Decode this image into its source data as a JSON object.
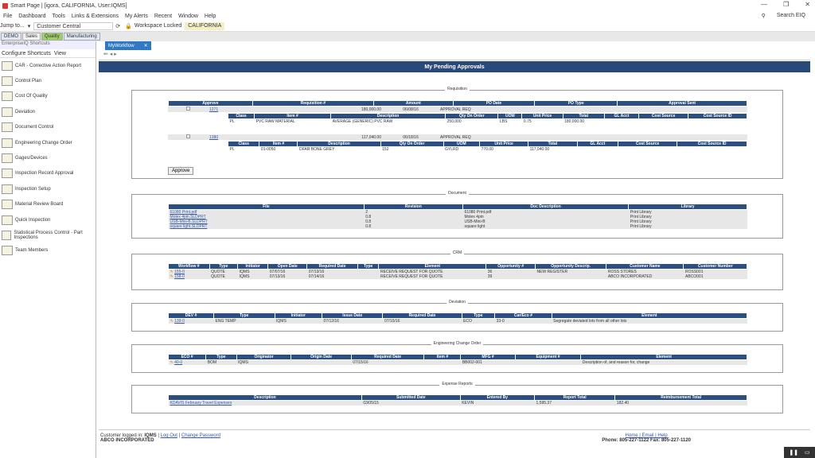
{
  "titlebar": {
    "title": "Smart Page | [igora, CALIFORNIA, User:IQMS]"
  },
  "menu": [
    "File",
    "Dashboard",
    "Tools",
    "Links & Extensions",
    "My Alerts",
    "Recent",
    "Window",
    "Help"
  ],
  "menu_right": "Search EIQ",
  "toolbar": {
    "jump": "Jump to...",
    "customer": "Customer Central",
    "workspace": "Workspace Locked",
    "location": "CALIFORNIA"
  },
  "tabs": [
    "DEMO",
    "Sales",
    "Quality",
    "Manufacturing"
  ],
  "sidebar": {
    "header": "EnterpriseIQ Shortcuts",
    "configure": "Configure Shortcuts",
    "view": "View",
    "items": [
      "CAR - Corrective Action Report",
      "Control Plan",
      "Cost Of Quality",
      "Deviation",
      "Document Control",
      "Engineering Change Order",
      "Gages/Devices",
      "Inspection Record Approval",
      "Inspection Setup",
      "Material Review Board",
      "Quick Inspection",
      "Statistical Process Control - Part Inspections",
      "Team Members"
    ]
  },
  "workflow_tab": "MyWorkflow",
  "page_title": "My Pending Approvals",
  "requisition": {
    "title": "Requisition",
    "headers": [
      "Approve",
      "Requisition #",
      "Amount",
      "PO Date",
      "PO Type",
      "Approval Sent"
    ],
    "sub_headers_1": [
      "Class",
      "Item #",
      "Description",
      "Qty On Order",
      "UOM",
      "Unit Price",
      "Total",
      "GL Acct",
      "Cost Source",
      "Cost Source ID"
    ],
    "rows": [
      {
        "req": "1271",
        "amount": "180,000.00",
        "date": "06/08/16",
        "type": "APPROVAL REQ",
        "line": [
          "PL",
          "PVC RAW MATERIAL",
          "AVERAGE (GENERIC) PVC RAW",
          "250,000",
          "LBS",
          "0.75",
          "180,000.00",
          "",
          "",
          ""
        ]
      },
      {
        "req": "1380",
        "amount": "117,040.00",
        "date": "06/18/16",
        "type": "APPROVAL REQ",
        "line": [
          "PL",
          "01-0050",
          "DFAR BONE GREY",
          "152",
          "GYLRD",
          "770.00",
          "117,040.00",
          "",
          "",
          ""
        ]
      }
    ],
    "approve_button": "Approve"
  },
  "document": {
    "title": "Document",
    "headers": [
      "File",
      "Revision",
      "Doc Description",
      "Library"
    ],
    "rows": [
      [
        "61080 Print.pdf",
        "2",
        "61080 Print.pdf",
        "Print Library"
      ],
      [
        "Molex 4pin.SLDPRT",
        "0.8",
        "Molex 4pin",
        "Print Library"
      ],
      [
        "USB-Mini-B.SLDPRT",
        "0.8",
        "USB-Mini-B",
        "Print Library"
      ],
      [
        "square light.SLDPRT",
        "0.8",
        "square light",
        "Print Library"
      ]
    ]
  },
  "crm": {
    "title": "CRM",
    "headers": [
      "Workflow #",
      "Type",
      "Initiator",
      "Open Date",
      "Required Date",
      "Type",
      "Element",
      "Opportunity #",
      "Opportunity Descrip.",
      "Customer Name",
      "Customer Number"
    ],
    "rows": [
      [
        "155-0",
        "QUOTE",
        "IQMS",
        "07/07/16",
        "07/13/16",
        "",
        "RECEIVE REQUEST FOR QUOTE",
        "36",
        "NEW REGISTER",
        "ROSS STORES",
        "ROSS001"
      ],
      [
        "158-0",
        "QUOTE",
        "IQMS",
        "07/13/16",
        "07/14/16",
        "",
        "RECEIVE REQUEST FOR QUOTE",
        "39",
        "",
        "ABCO INCORPORATED",
        "ABCO001"
      ]
    ]
  },
  "deviation": {
    "title": "Deviation",
    "headers": [
      "DEV #",
      "Type",
      "Initiator",
      "Issue Date",
      "Required Date",
      "Type",
      "Car/Eco #",
      "Element"
    ],
    "rows": [
      [
        "139-0",
        "ENG TEMP",
        "IQMS",
        "07/12/16",
        "07/15/16",
        "ECO",
        "33-0",
        "Segregate deviated lots from all other lots"
      ]
    ]
  },
  "eco": {
    "title": "Engineering Change Order",
    "headers": [
      "ECO #",
      "Type",
      "Originator",
      "Origin Date",
      "Required Date",
      "Item #",
      "MFG #",
      "Equipment #",
      "Element"
    ],
    "rows": [
      [
        "40-0",
        "BOM",
        "IQMS",
        "",
        "07/15/16",
        "",
        "BB002-001",
        "",
        "Description of, and reason for, change"
      ]
    ]
  },
  "expense": {
    "title": "Expense Reports",
    "headers": [
      "Description",
      "Submitted Date",
      "Entered By",
      "Report Total",
      "Reimbursement Total"
    ],
    "rows": [
      [
        "KDAVIS February Travel Expenses",
        "03/05/15",
        "KEVIN",
        "1,595.37",
        "182.40"
      ]
    ]
  },
  "footer": {
    "logged": "Customer logged in:",
    "user": "IQMS",
    "logout": "Log Out",
    "change": "Change Password",
    "company": "ABCO INCORPORATED",
    "links": "Home | Email | Help",
    "phone": "Phone: 805-227-1122   Fax: 805-227-1120"
  }
}
